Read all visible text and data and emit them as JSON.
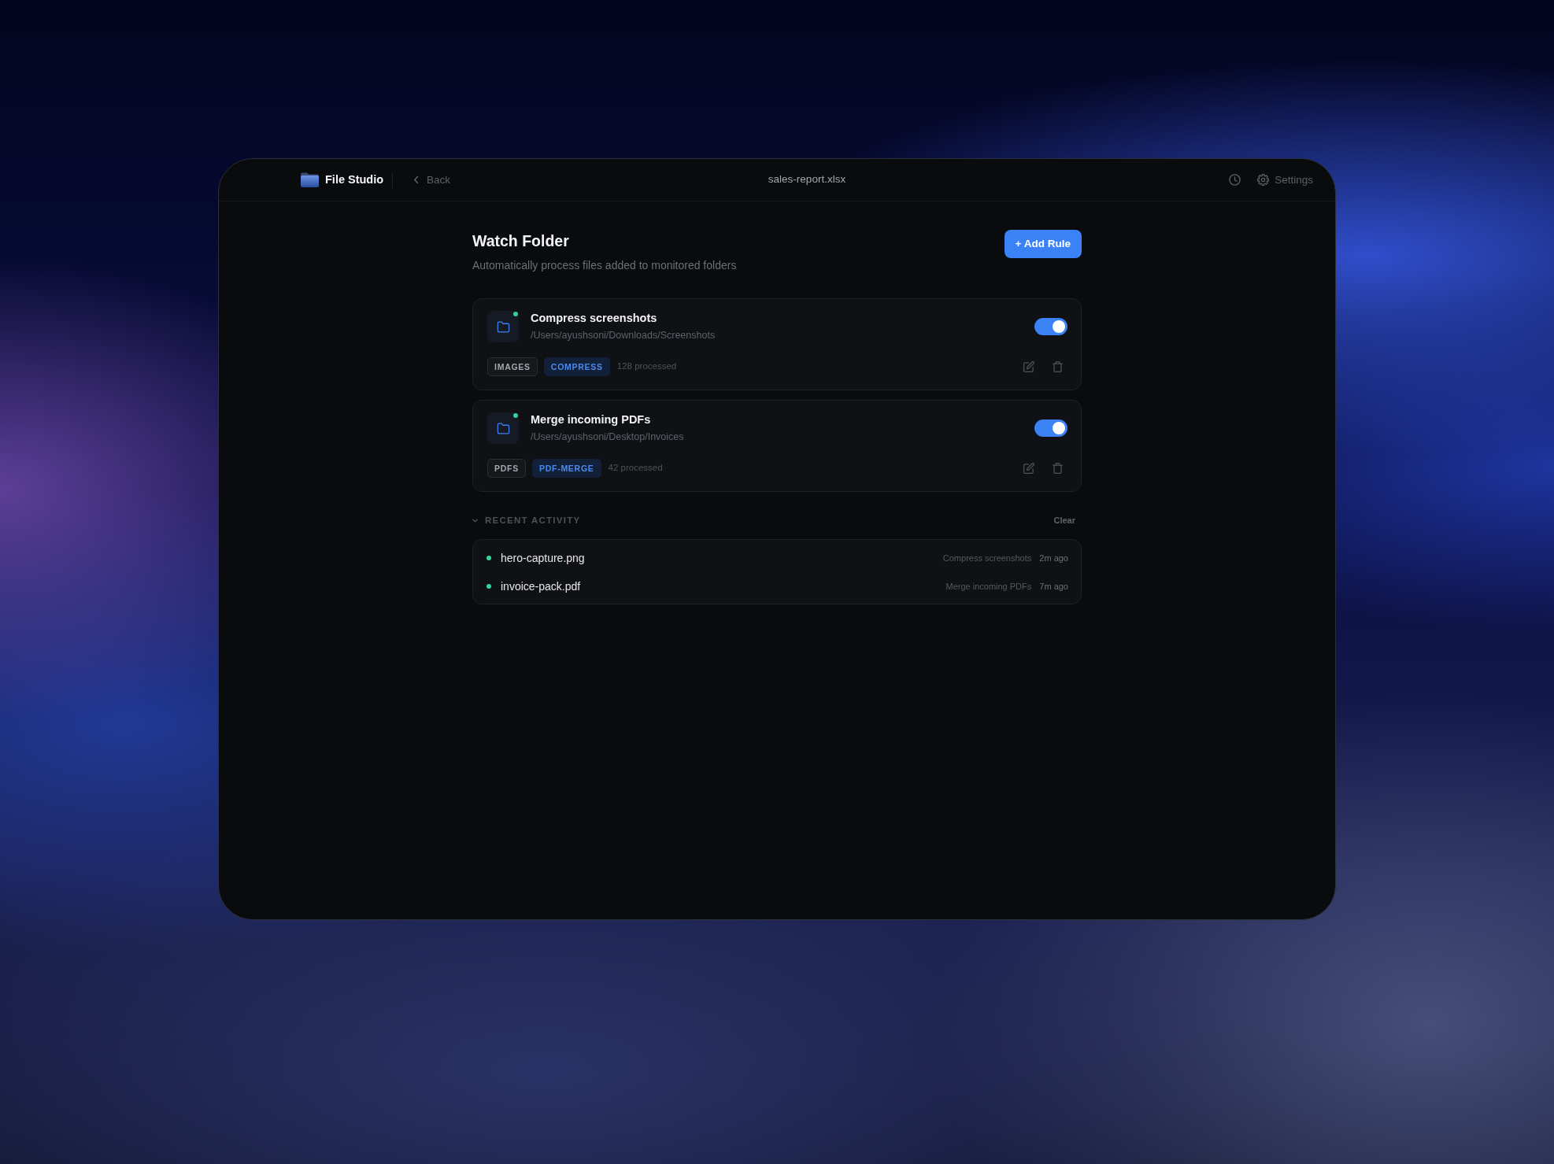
{
  "app": {
    "name": "File Studio",
    "back": "Back"
  },
  "window": {
    "title": "sales-report.xlsx"
  },
  "toolbar": {
    "settings": "Settings"
  },
  "header": {
    "title": "Watch Folder",
    "subtitle": "Automatically process files added to monitored folders",
    "add_button": "+ Add Rule"
  },
  "rules": [
    {
      "name": "Compress screenshots",
      "path": "/Users/ayushsoni/Downloads/Screenshots",
      "watching": true,
      "enabled": true,
      "tags": [
        {
          "label": "IMAGES",
          "kind": "category"
        },
        {
          "label": "COMPRESS",
          "kind": "action"
        }
      ],
      "processed": "128 processed"
    },
    {
      "name": "Merge incoming PDFs",
      "path": "/Users/ayushsoni/Desktop/Invoices",
      "watching": true,
      "enabled": true,
      "tags": [
        {
          "label": "PDFS",
          "kind": "category"
        },
        {
          "label": "PDF-MERGE",
          "kind": "action"
        }
      ],
      "processed": "42 processed"
    }
  ],
  "recent_activity": {
    "title": "RECENT ACTIVITY",
    "expanded": true,
    "clear": "Clear",
    "items": [
      {
        "file": "hero-capture.png",
        "rule": "Compress screenshots",
        "time": "2m ago",
        "color": "#34d399"
      },
      {
        "file": "invoice-pack.pdf",
        "rule": "Merge incoming PDFs",
        "time": "7m ago",
        "color": "#34d399"
      }
    ]
  }
}
